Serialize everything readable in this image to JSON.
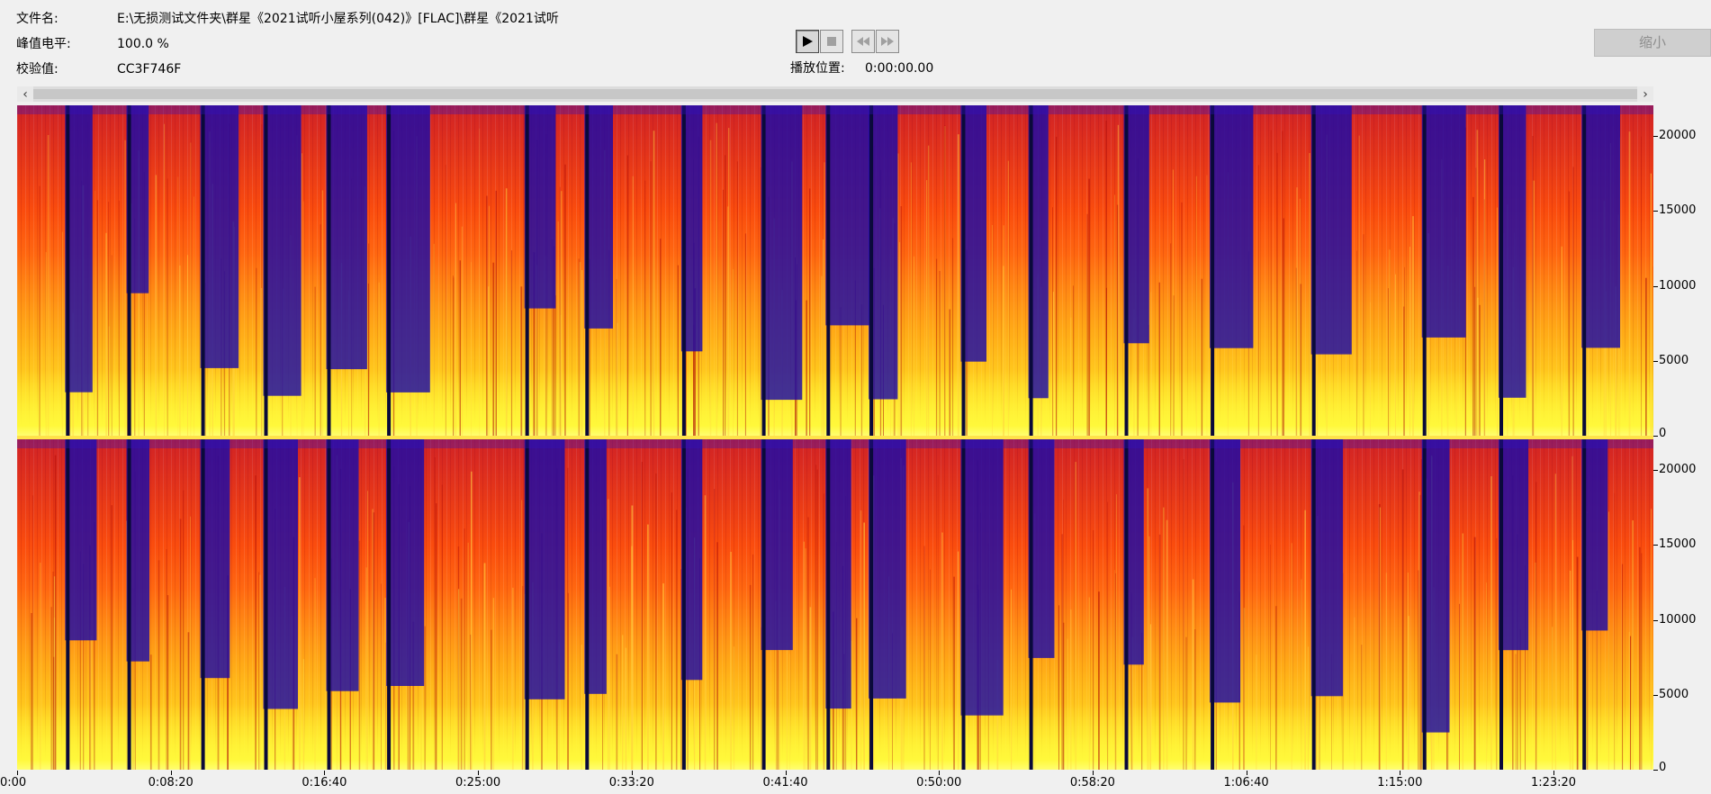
{
  "info": {
    "filename_label": "文件名:",
    "filename_value": "E:\\无损测试文件夹\\群星《2021试听小屋系列(042)》[FLAC]\\群星《2021试听",
    "peak_label": "峰值电平:",
    "peak_value": "100.0 %",
    "checksum_label": "校验值:",
    "checksum_value": "CC3F746F"
  },
  "playback": {
    "position_label": "播放位置:",
    "position_value": "0:00:00.00"
  },
  "toolbar": {
    "shrink_label": "缩小"
  },
  "icons": {
    "play": "play-icon",
    "stop": "stop-icon",
    "rewind": "rewind-icon",
    "fast_forward": "fast-forward-icon",
    "scroll_left": "chevron-left-icon",
    "scroll_right": "chevron-right-icon"
  },
  "colors": {
    "spectrum_low": "#1a0aa8",
    "spectrum_mid": "#ee2a08",
    "spectrum_high": "#fff04a",
    "background": "#f0f0f0"
  },
  "freq_axis": {
    "labels": [
      "20000",
      "15000",
      "10000",
      "5000",
      "0"
    ],
    "values": [
      20000,
      15000,
      10000,
      5000,
      0
    ],
    "max": 22050
  },
  "time_axis": {
    "labels": [
      "0:00",
      "0:08:20",
      "0:16:40",
      "0:25:00",
      "0:33:20",
      "0:41:40",
      "0:50:00",
      "0:58:20",
      "1:06:40",
      "1:15:00",
      "1:23:20"
    ],
    "seconds": [
      0,
      500,
      1000,
      1500,
      2000,
      2500,
      3000,
      3500,
      4000,
      4500,
      5000
    ],
    "total_seconds": 5325
  },
  "tracks": {
    "boundary_seconds": [
      165,
      365,
      605,
      810,
      1015,
      1210,
      1660,
      1855,
      2170,
      2430,
      2640,
      2780,
      3080,
      3300,
      3610,
      3890,
      4220,
      4580,
      4830,
      5100
    ]
  }
}
